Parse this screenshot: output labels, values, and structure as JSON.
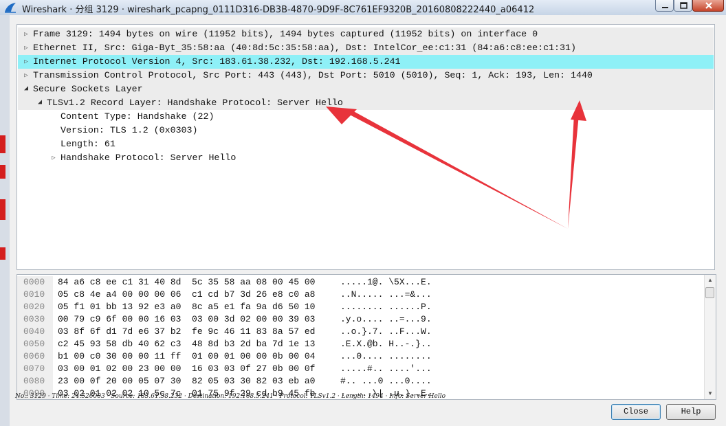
{
  "window": {
    "title": "Wireshark · 分组 3129 · wireshark_pcapng_0111D316-DB3B-4870-9D9F-8C761EF9320B_20160808222440_a06412",
    "app_icon": "wireshark-fin-icon",
    "controls": [
      "minimize-icon",
      "maximize-icon",
      "close-icon"
    ]
  },
  "tree": {
    "rows": [
      {
        "text": "Frame 3129: 1494 bytes on wire (11952 bits), 1494 bytes captured (11952 bits) on interface 0",
        "expander": "collapsed"
      },
      {
        "text": "Ethernet II, Src: Giga-Byt_35:58:aa (40:8d:5c:35:58:aa), Dst: IntelCor_ee:c1:31 (84:a6:c8:ee:c1:31)",
        "expander": "collapsed"
      },
      {
        "text": "Internet Protocol Version 4, Src: 183.61.38.232, Dst: 192.168.5.241",
        "expander": "collapsed",
        "selected": true
      },
      {
        "text": "Transmission Control Protocol, Src Port: 443 (443), Dst Port: 5010 (5010), Seq: 1, Ack: 193, Len: 1440",
        "expander": "collapsed"
      },
      {
        "text": "Secure Sockets Layer",
        "expander": "expanded"
      },
      {
        "text": "TLSv1.2 Record Layer: Handshake Protocol: Server Hello",
        "expander": "expanded"
      },
      {
        "text": "Content Type: Handshake (22)",
        "expander": "none"
      },
      {
        "text": "Version: TLS 1.2 (0x0303)",
        "expander": "none"
      },
      {
        "text": "Length: 61",
        "expander": "none"
      },
      {
        "text": "Handshake Protocol: Server Hello",
        "expander": "collapsed"
      }
    ]
  },
  "hex": {
    "rows": [
      {
        "offset": "0000",
        "bytes": "84 a6 c8 ee c1 31 40 8d  5c 35 58 aa 08 00 45 00",
        "ascii": ".....1@. \\5X...E."
      },
      {
        "offset": "0010",
        "bytes": "05 c8 4e a4 00 00 00 06  c1 cd b7 3d 26 e8 c0 a8",
        "ascii": "..N..... ...=&..."
      },
      {
        "offset": "0020",
        "bytes": "05 f1 01 bb 13 92 e3 a0  8c a5 e1 fa 9a d6 50 10",
        "ascii": "........ ......P."
      },
      {
        "offset": "0030",
        "bytes": "00 79 c9 6f 00 00 16 03  03 00 3d 02 00 00 39 03",
        "ascii": ".y.o.... ..=...9."
      },
      {
        "offset": "0040",
        "bytes": "03 8f 6f d1 7d e6 37 b2  fe 9c 46 11 83 8a 57 ed",
        "ascii": "..o.}.7. ..F...W."
      },
      {
        "offset": "0050",
        "bytes": "c2 45 93 58 db 40 62 c3  48 8d b3 2d ba 7d 1e 13",
        "ascii": ".E.X.@b. H..-.}.."
      },
      {
        "offset": "0060",
        "bytes": "b1 00 c0 30 00 00 11 ff  01 00 01 00 00 0b 00 04",
        "ascii": "...0.... ........"
      },
      {
        "offset": "0070",
        "bytes": "03 00 01 02 00 23 00 00  16 03 03 0f 27 0b 00 0f",
        "ascii": ".....#.. ....'..."
      },
      {
        "offset": "0080",
        "bytes": "23 00 0f 20 00 05 07 30  82 05 03 30 82 03 eb a0",
        "ascii": "#.. ...0 ...0...."
      },
      {
        "offset": "0090",
        "bytes": "03 02 01 02 02 10 5c 7c  01 75 9f 29 cd b9 45 fb",
        "ascii": "......\\| .u.)..E."
      }
    ]
  },
  "status": {
    "text": "No.: 3129 · Time: 24.526003 · Source: 183.61.38.232 · Destination: 192.168.5.241 · Protocol: TLSv1.2 · Length: 1494 · Info: Server Hello"
  },
  "buttons": {
    "close_label": "Close",
    "help_label": "Help"
  },
  "annotation": {
    "arrow_color": "#e8333b"
  }
}
